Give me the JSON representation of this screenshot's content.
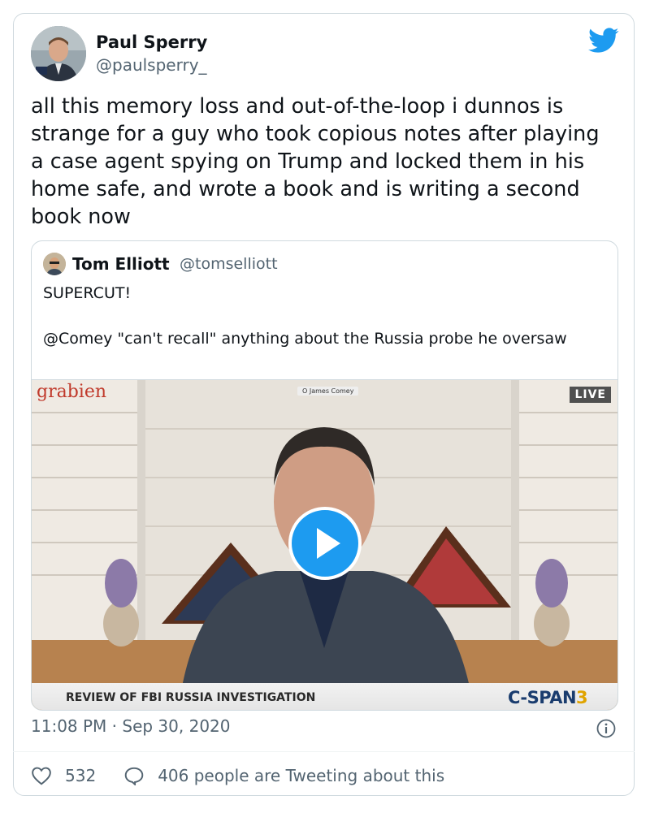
{
  "tweet": {
    "author_name": "Paul Sperry",
    "author_handle": "@paulsperry_",
    "text": "all this memory loss and out-of-the-loop i dunnos is strange for a guy who took copious notes after playing a case agent spying on Trump and locked them in his home safe, and wrote a book and is writing a second book now",
    "timestamp": "11:08 PM · Sep 30, 2020",
    "likes": "532",
    "tweeting_about": "406 people are Tweeting about this"
  },
  "quoted": {
    "author_name": "Tom Elliott",
    "author_handle": "@tomselliott",
    "line1": "SUPERCUT!",
    "line2": "@Comey \"can't recall\" anything about the Russia probe he oversaw"
  },
  "video": {
    "watermark": "grabien",
    "live_label": "LIVE",
    "name_tag": "O James Comey",
    "lower_third": "REVIEW OF FBI RUSSIA INVESTIGATION",
    "network": "C-SPAN",
    "network_num": "3"
  },
  "icons": [
    "twitter-bird-icon",
    "play-icon",
    "info-icon",
    "heart-icon",
    "reply-bubble-icon"
  ],
  "colors": {
    "brand_blue": "#1d9bf0",
    "text": "#0f1419",
    "secondary": "#536471",
    "border": "#cfd9de"
  }
}
